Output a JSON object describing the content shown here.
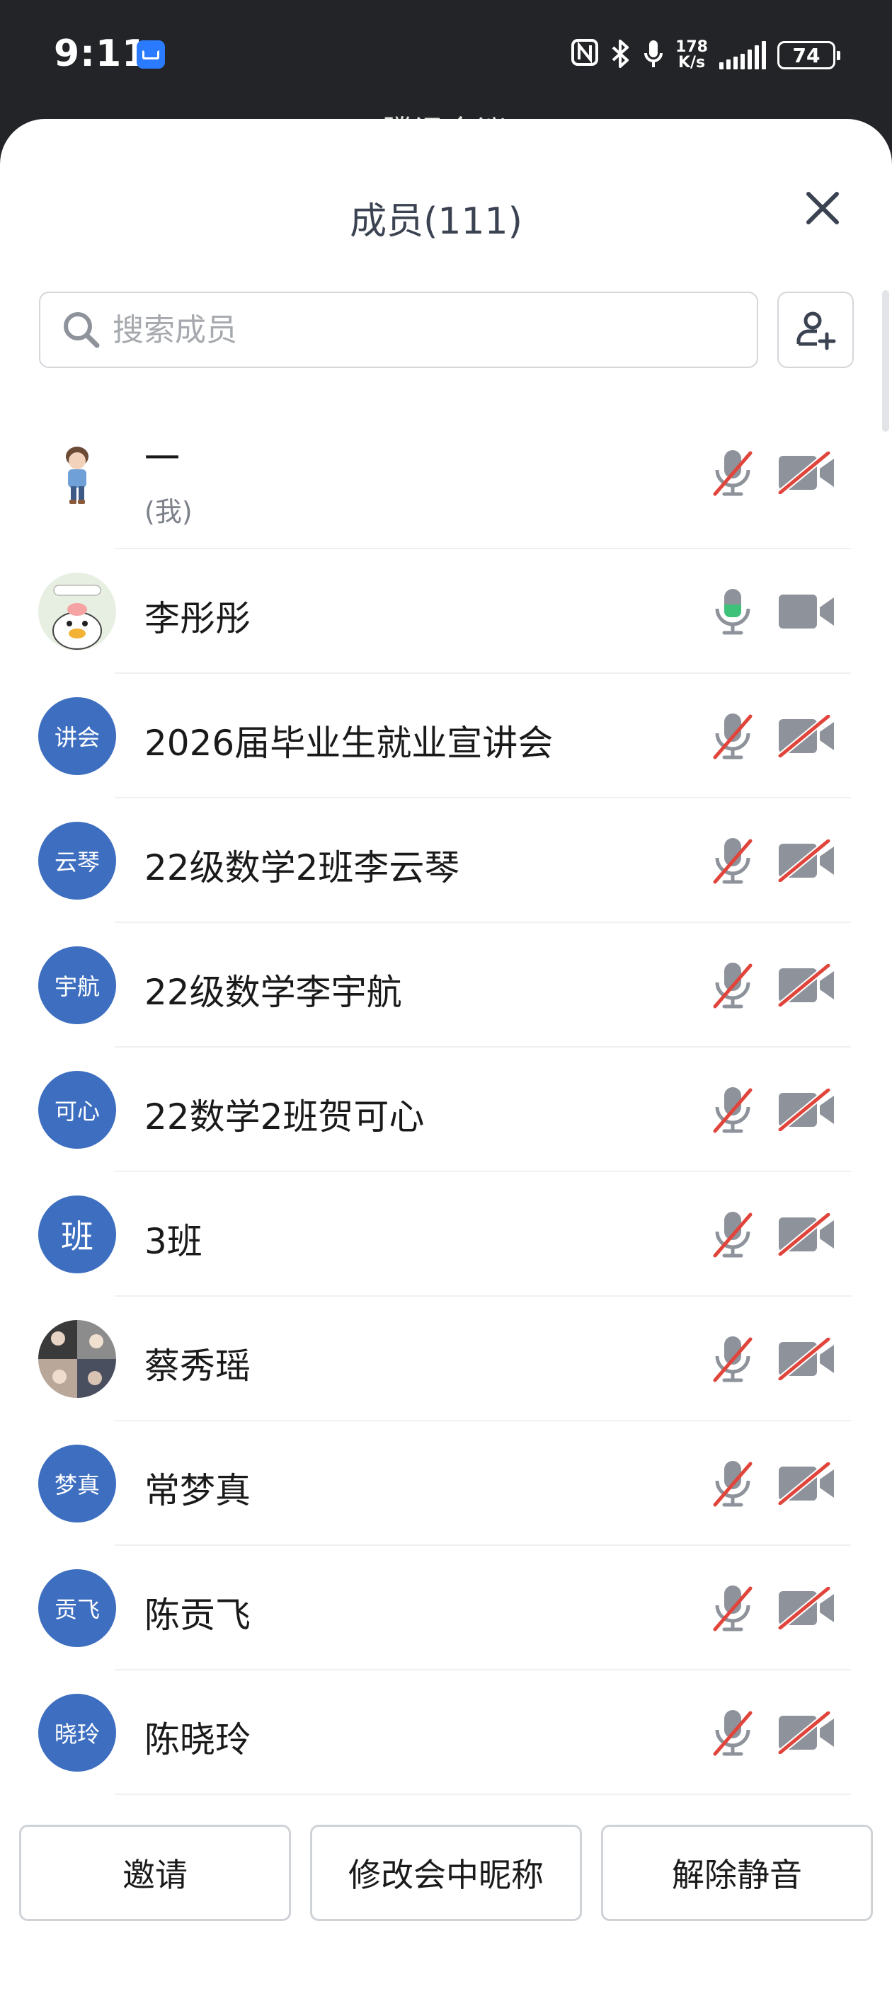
{
  "status_bar": {
    "time": "9:11",
    "net_speed_value": "178",
    "net_speed_unit": "K/s",
    "battery": "74"
  },
  "background_title": "腾讯会议",
  "sheet": {
    "title": "成员(111)",
    "search_placeholder": "搜索成员"
  },
  "members": [
    {
      "name": "一",
      "sub": "(我)",
      "avatar_type": "photo-boy",
      "mic": "muted",
      "camera": "off"
    },
    {
      "name": "李彤彤",
      "avatar_type": "photo-duck",
      "mic": "on",
      "camera": "on"
    },
    {
      "name": "2026届毕业生就业宣讲会",
      "avatar_text": "讲会",
      "avatar_type": "text",
      "mic": "muted",
      "camera": "off"
    },
    {
      "name": "22级数学2班李云琴",
      "avatar_text": "云琴",
      "avatar_type": "text",
      "mic": "muted",
      "camera": "off"
    },
    {
      "name": "22级数学李宇航",
      "avatar_text": "宇航",
      "avatar_type": "text",
      "mic": "muted",
      "camera": "off"
    },
    {
      "name": "22数学2班贺可心",
      "avatar_text": "可心",
      "avatar_type": "text",
      "mic": "muted",
      "camera": "off"
    },
    {
      "name": "3班",
      "avatar_text": "班",
      "avatar_type": "text",
      "mic": "muted",
      "camera": "off"
    },
    {
      "name": "蔡秀瑶",
      "avatar_type": "photo-collage",
      "mic": "muted",
      "camera": "off"
    },
    {
      "name": "常梦真",
      "avatar_text": "梦真",
      "avatar_type": "text",
      "mic": "muted",
      "camera": "off"
    },
    {
      "name": "陈贡飞",
      "avatar_text": "贡飞",
      "avatar_type": "text",
      "mic": "muted",
      "camera": "off"
    },
    {
      "name": "陈晓玲",
      "avatar_text": "晓玲",
      "avatar_type": "text",
      "mic": "muted",
      "camera": "off"
    }
  ],
  "footer": {
    "invite": "邀请",
    "rename": "修改会中昵称",
    "unmute": "解除静音"
  },
  "colors": {
    "avatar_blue": "#3d6ec0",
    "muted_red": "#e0443a",
    "icon_gray": "#8e939b",
    "mic_active_green": "#3ec27a"
  }
}
